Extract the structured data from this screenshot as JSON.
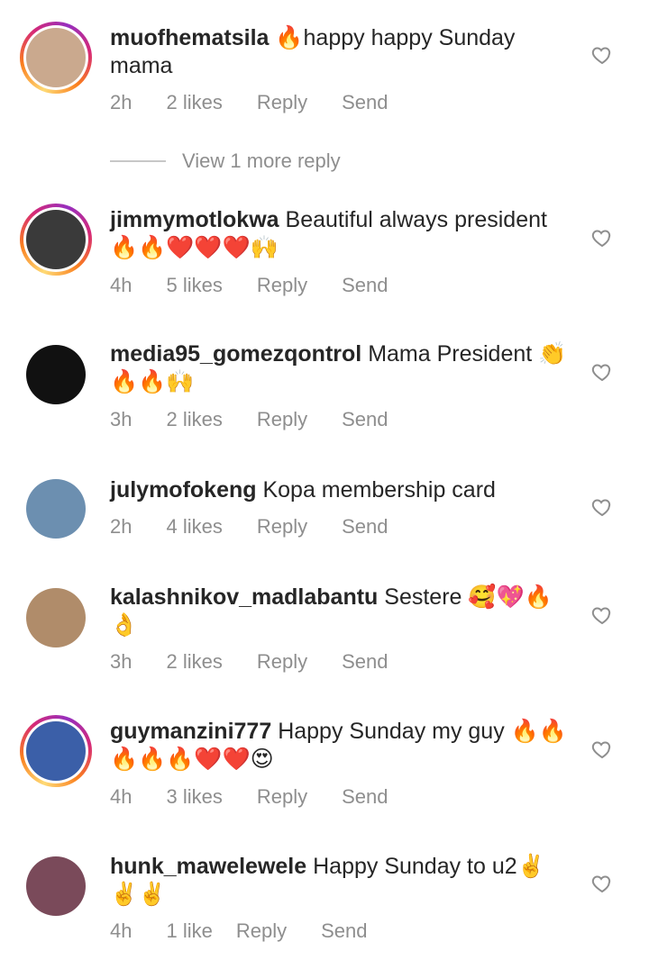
{
  "view_more_label": "View 1 more reply",
  "comments": [
    {
      "username": "muofhematsila",
      "text": "🔥happy happy Sunday mama",
      "time": "2h",
      "likes": "2 likes",
      "reply_label": "Reply",
      "send_label": "Send",
      "avatar_bg": "#caa98e"
    },
    {
      "username": "jimmymotlokwa",
      "text": "Beautiful always president 🔥🔥❤️❤️❤️🙌",
      "time": "4h",
      "likes": "5 likes",
      "reply_label": "Reply",
      "send_label": "Send",
      "avatar_bg": "#3a3a3a"
    },
    {
      "username": "media95_gomezqontrol",
      "text": "Mama President 👏 🔥🔥🙌",
      "time": "3h",
      "likes": "2 likes",
      "reply_label": "Reply",
      "send_label": "Send",
      "avatar_bg": "#111111"
    },
    {
      "username": "julymofokeng",
      "text": "Kopa membership card",
      "time": "2h",
      "likes": "4 likes",
      "reply_label": "Reply",
      "send_label": "Send",
      "avatar_bg": "#6c8fb0"
    },
    {
      "username": "kalashnikov_madlabantu",
      "text": "Sestere 🥰💖🔥 👌",
      "time": "3h",
      "likes": "2 likes",
      "reply_label": "Reply",
      "send_label": "Send",
      "avatar_bg": "#b08c6a"
    },
    {
      "username": "guymanzini777",
      "text": "Happy Sunday my guy 🔥🔥 🔥🔥🔥❤️❤️😍",
      "time": "4h",
      "likes": "3 likes",
      "reply_label": "Reply",
      "send_label": "Send",
      "avatar_bg": "#3b5fa8"
    },
    {
      "username": "hunk_mawelewele",
      "text": "Happy Sunday to u2✌️ ✌️✌️",
      "time": "4h",
      "likes": "1 like",
      "reply_label": "Reply",
      "send_label": "Send",
      "avatar_bg": "#7a4a5a"
    }
  ]
}
